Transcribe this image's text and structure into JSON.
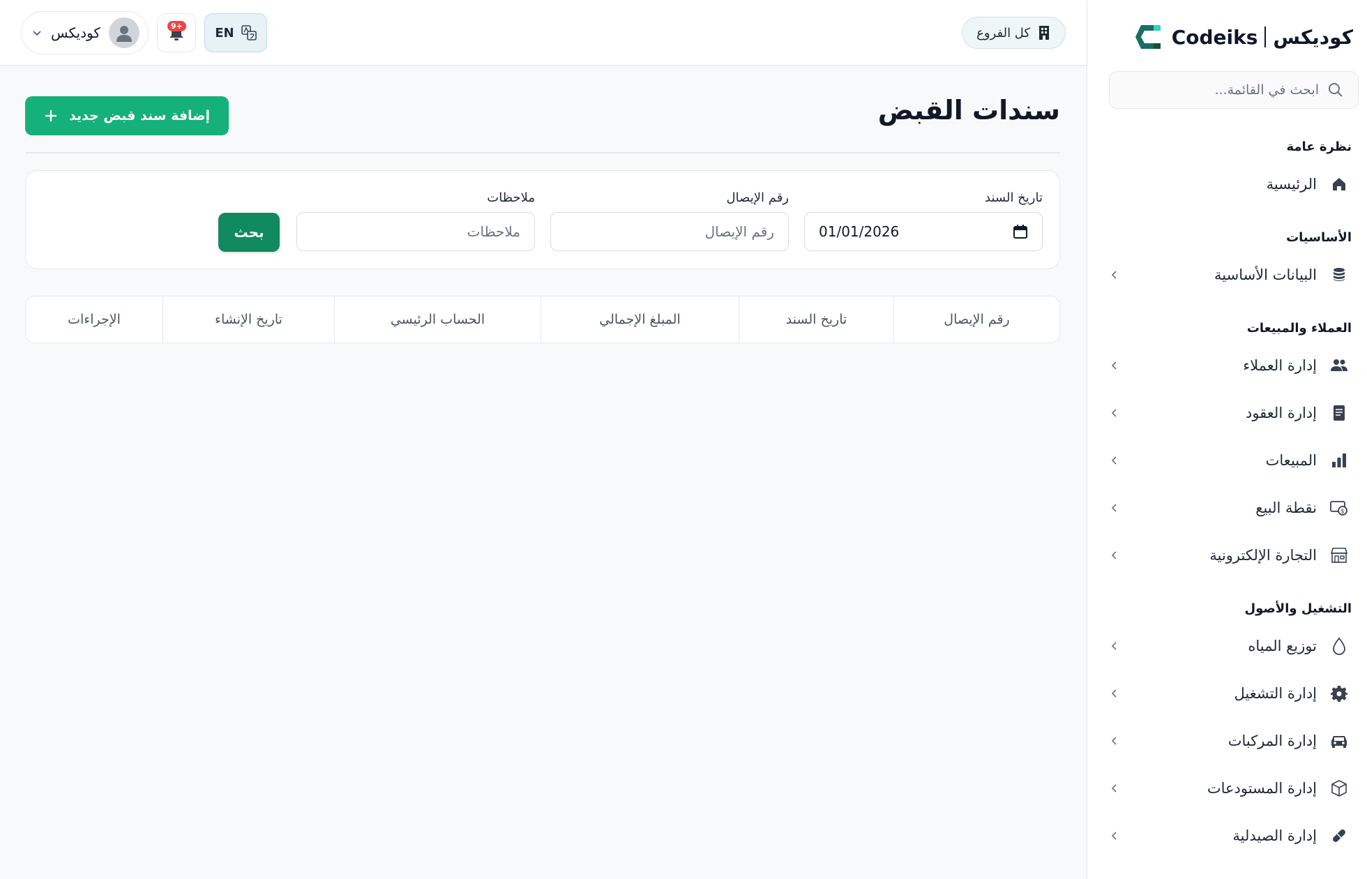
{
  "brand": {
    "name_ar": "كوديكس",
    "name_en": "Codeiks"
  },
  "sidebar": {
    "search_placeholder": "ابحث في القائمة...",
    "sections": [
      {
        "title": "نظرة عامة",
        "items": [
          {
            "label": "الرئيسية",
            "icon": "home-icon",
            "chevron": false
          }
        ]
      },
      {
        "title": "الأساسيات",
        "items": [
          {
            "label": "البيانات الأساسية",
            "icon": "database-icon",
            "chevron": true
          }
        ]
      },
      {
        "title": "العملاء والمبيعات",
        "items": [
          {
            "label": "إدارة العملاء",
            "icon": "users-icon",
            "chevron": true
          },
          {
            "label": "إدارة العقود",
            "icon": "document-icon",
            "chevron": true
          },
          {
            "label": "المبيعات",
            "icon": "bar-chart-icon",
            "chevron": true
          },
          {
            "label": "نقطة البيع",
            "icon": "cash-icon",
            "chevron": true
          },
          {
            "label": "التجارة الإلكترونية",
            "icon": "store-icon",
            "chevron": true
          }
        ]
      },
      {
        "title": "التشغيل والأصول",
        "items": [
          {
            "label": "توزيع المياه",
            "icon": "water-drop-icon",
            "chevron": true
          },
          {
            "label": "إدارة التشغيل",
            "icon": "gear-icon",
            "chevron": true
          },
          {
            "label": "إدارة المركبات",
            "icon": "car-icon",
            "chevron": true
          },
          {
            "label": "إدارة المستودعات",
            "icon": "box-icon",
            "chevron": true
          },
          {
            "label": "إدارة الصيدلية",
            "icon": "pill-icon",
            "chevron": true
          }
        ]
      }
    ]
  },
  "topbar": {
    "branch_label": "كل الفروع",
    "lang_label": "EN",
    "notification_count": "9+",
    "user_name": "كوديكس"
  },
  "page": {
    "title": "سندات القبض",
    "add_button": "إضافة سند قبض جديد"
  },
  "filters": {
    "date_label": "تاريخ السند",
    "date_value": "01/01/2026",
    "receipt_label": "رقم الإيصال",
    "receipt_placeholder": "رقم الإيصال",
    "notes_label": "ملاحظات",
    "notes_placeholder": "ملاحظات",
    "search_button": "بحث"
  },
  "table": {
    "columns": [
      "رقم الإيصال",
      "تاريخ السند",
      "المبلغ الإجمالي",
      "الحساب الرئيسي",
      "تاريخ الإنشاء",
      "الإجراءات"
    ]
  },
  "colors": {
    "primary": "#16b07a",
    "primary_dark": "#128a5f",
    "brand_teal": "#1a6d63",
    "badge": "#ef4444"
  }
}
